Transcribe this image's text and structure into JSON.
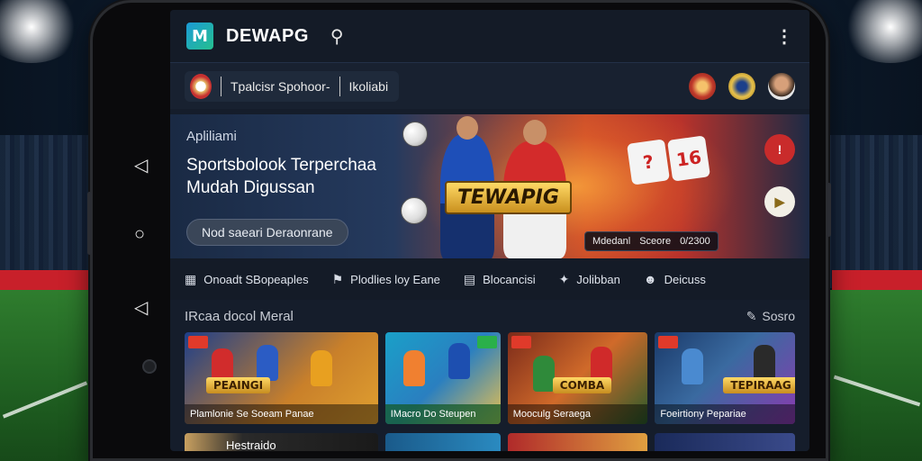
{
  "app": {
    "brand": "DEWAPG",
    "logo_letter": "M"
  },
  "subbar": {
    "primary_label": "Tpalcisr Spohoor-",
    "secondary_label": "Ikoliabi"
  },
  "hero": {
    "kicker": "Apliliami",
    "title_line1": "Sportsbolook Terperchaa",
    "title_line2": "Mudah Digussan",
    "cta": "Nod saeari Deraonrane",
    "banner_logo": "TEWAPIG",
    "score_items": [
      "Mdedanl",
      "Sceore",
      "0/2300"
    ]
  },
  "tabs": [
    {
      "icon": "ticket-icon",
      "label": "Onoadt SBopeaples"
    },
    {
      "icon": "flag-icon",
      "label": "Plodlies loy Eane"
    },
    {
      "icon": "news-icon",
      "label": "Blocancisi"
    },
    {
      "icon": "star-icon",
      "label": "Jolibban"
    },
    {
      "icon": "user-icon",
      "label": "Deicuss"
    }
  ],
  "section": {
    "title": "IRcaa docol Meral",
    "link": "Sosro"
  },
  "cards": [
    {
      "caption": "Plamlonie Se Soeam Panae",
      "banner": "PEAINGI"
    },
    {
      "caption": "IMacro Do Steupen",
      "banner": ""
    },
    {
      "caption": "Mooculg Seraega",
      "banner": "COMBA"
    },
    {
      "caption": "Foeirtiony Pepariae",
      "banner": "TEPIRAAG"
    }
  ],
  "row2": [
    {
      "label": "Hestraido"
    },
    {
      "label": ""
    },
    {
      "label": ""
    },
    {
      "label": ""
    }
  ],
  "colors": {
    "accent_red": "#c8202a",
    "gold": "#ffd966",
    "screen_bg": "#151d2b"
  }
}
